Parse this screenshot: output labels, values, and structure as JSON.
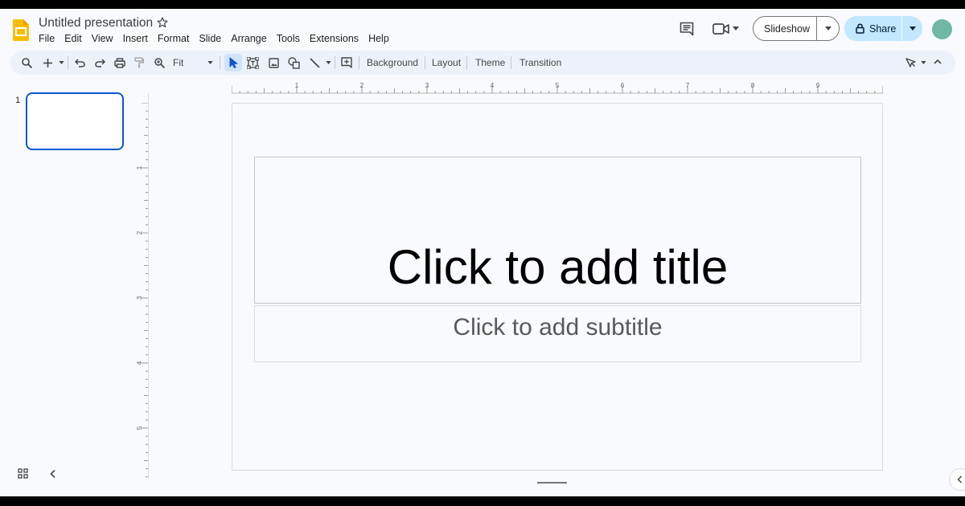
{
  "header": {
    "title": "Untitled presentation",
    "menu": [
      "File",
      "Edit",
      "View",
      "Insert",
      "Format",
      "Slide",
      "Arrange",
      "Tools",
      "Extensions",
      "Help"
    ],
    "slideshow_label": "Slideshow",
    "share_label": "Share",
    "icons": [
      "slides-logo",
      "star-icon",
      "comments-icon",
      "meet-icon",
      "lock-icon",
      "avatar"
    ]
  },
  "toolbar": {
    "zoom_label": "Fit",
    "background_label": "Background",
    "layout_label": "Layout",
    "theme_label": "Theme",
    "transition_label": "Transition",
    "icons": [
      "search-icon",
      "add-icon",
      "undo-icon",
      "redo-icon",
      "print-icon",
      "paint-format-icon",
      "zoom-icon",
      "select-icon",
      "text-box-icon",
      "image-icon",
      "shape-icon",
      "line-icon",
      "comment-add-icon",
      "pen-icon",
      "collapse-toolbar-icon"
    ]
  },
  "rulers": {
    "top_labels": [
      "1",
      "2",
      "3",
      "4",
      "5",
      "6",
      "7",
      "8",
      "9"
    ],
    "left_labels": [
      "1",
      "2",
      "3",
      "4",
      "5"
    ]
  },
  "filmstrip": {
    "slide_number": "1"
  },
  "slide": {
    "title_placeholder": "Click to add title",
    "subtitle_placeholder": "Click to add subtitle"
  },
  "colors": {
    "accent": "#0b57d0",
    "share_bg": "#c2e7ff",
    "toolbar_bg": "#edf2fa",
    "logo": "#fbbc04",
    "avatar": "#6fb8a5"
  }
}
